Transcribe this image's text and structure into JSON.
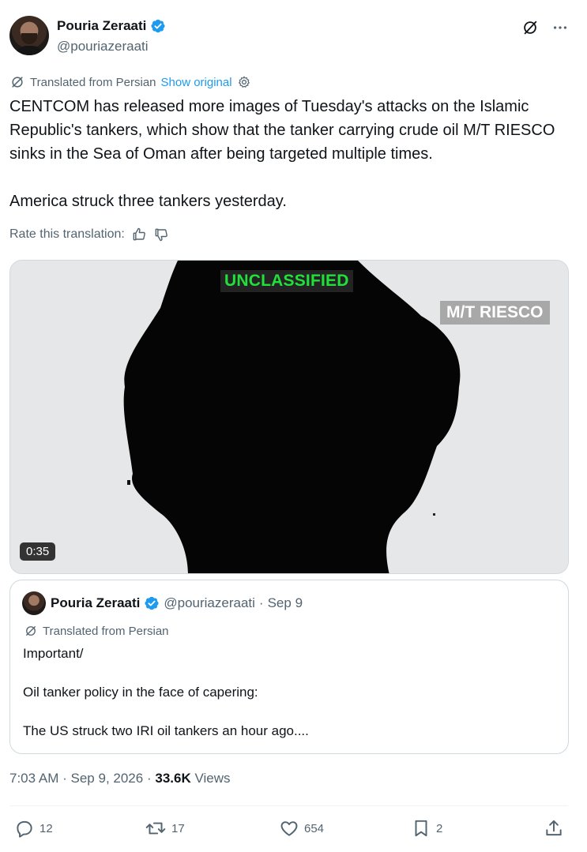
{
  "author": {
    "name": "Pouria Zeraati",
    "handle": "@pouriazeraati"
  },
  "translation": {
    "label": "Translated from Persian",
    "show_original": "Show original"
  },
  "post": {
    "paragraphs": [
      "CENTCOM has released more images of Tuesday's attacks on the Islamic Republic's tankers, which show that the tanker carrying crude oil M/T RIESCO sinks in the Sea of Oman after being targeted multiple times.",
      "America struck three tankers yesterday."
    ]
  },
  "rate": {
    "label": "Rate this translation:"
  },
  "video": {
    "overlay_top": "UNCLASSIFIED",
    "overlay_right": "M/T RIESCO",
    "duration": "0:35"
  },
  "quote": {
    "name": "Pouria Zeraati",
    "handle": "@pouriazeraati",
    "sep": "·",
    "date": "Sep 9",
    "translated": "Translated from Persian",
    "lines": [
      "Important/",
      "Oil tanker policy in the face of capering:",
      "The US struck two IRI oil tankers an hour ago...."
    ]
  },
  "meta": {
    "time": "7:03 AM",
    "sep1": "·",
    "date": "Sep 9, 2026",
    "sep2": "·",
    "views_count": "33.6K",
    "views_label": "Views"
  },
  "actions": {
    "replies": "12",
    "reposts": "17",
    "likes": "654",
    "bookmarks": "2"
  },
  "colors": {
    "accent": "#1d9bf0",
    "text": "#0f1419",
    "muted": "#536471",
    "overlay_green": "#22e03a"
  }
}
